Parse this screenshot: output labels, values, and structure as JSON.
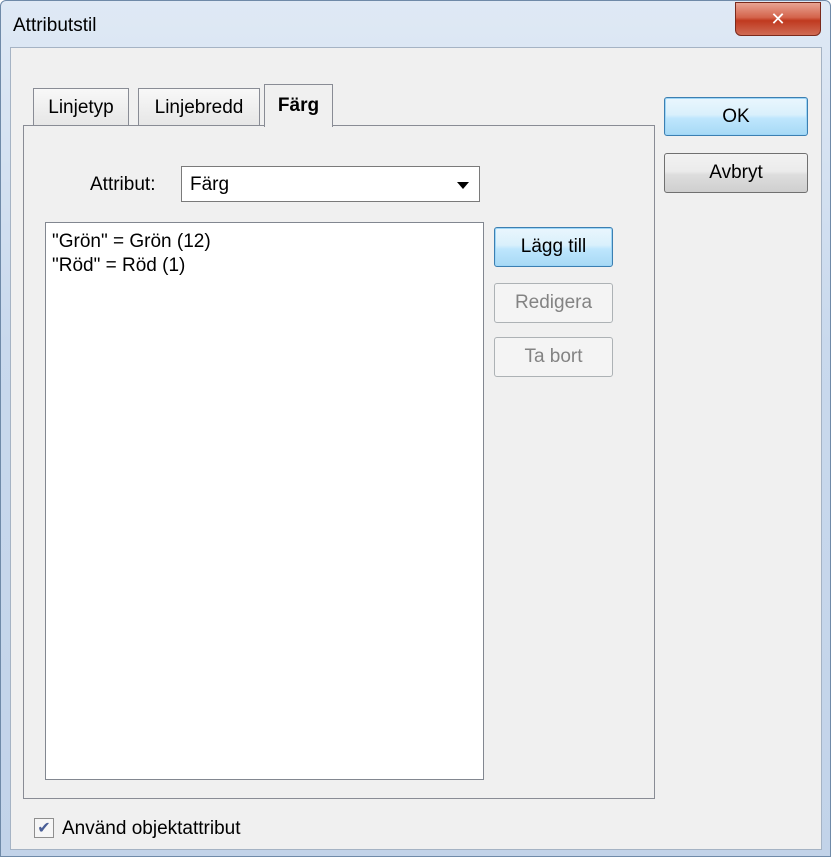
{
  "window": {
    "title": "Attributstil",
    "close_glyph": "✕"
  },
  "tabs": [
    {
      "label": "Linjetyp",
      "active": false
    },
    {
      "label": "Linjebredd",
      "active": false
    },
    {
      "label": "Färg",
      "active": true
    }
  ],
  "attribute": {
    "label": "Attribut:",
    "selected": "Färg"
  },
  "list": {
    "items": [
      "\"Grön\" = Grön (12)",
      "\"Röd\" = Röd (1)"
    ]
  },
  "side_buttons": {
    "add": "Lägg till",
    "edit": "Redigera",
    "remove": "Ta bort"
  },
  "dialog_buttons": {
    "ok": "OK",
    "cancel": "Avbryt"
  },
  "footer": {
    "checkbox_label": "Använd objektattribut",
    "checkbox_checked": true,
    "check_glyph": "✔"
  },
  "colors": {
    "close_button": "#c8442a",
    "default_button_border": "#3c7fb1",
    "check_mark": "#4a5f97"
  }
}
